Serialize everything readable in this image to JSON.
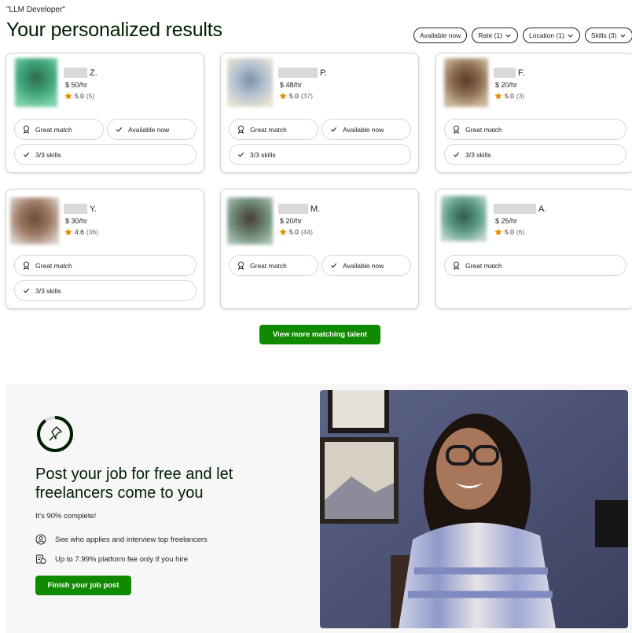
{
  "search": {
    "query": "\"LLM Developer\""
  },
  "page": {
    "title": "Your personalized results"
  },
  "filters": [
    {
      "label": "Available now",
      "has_menu": false
    },
    {
      "label": "Rate (1)",
      "has_menu": true
    },
    {
      "label": "Location (1)",
      "has_menu": true
    },
    {
      "label": "Skills (3)",
      "has_menu": true
    }
  ],
  "talent": [
    {
      "name_initial": "Z.",
      "rate": "$ 50/hr",
      "rating": "5.0",
      "reviews": "(5)",
      "tags": [
        "Great match",
        "Available now",
        "3/3 skills"
      ]
    },
    {
      "name_initial": "P.",
      "rate": "$ 48/hr",
      "rating": "5.0",
      "reviews": "(37)",
      "tags": [
        "Great match",
        "Available now",
        "3/3 skills"
      ]
    },
    {
      "name_initial": "F.",
      "rate": "$ 20/hr",
      "rating": "5.0",
      "reviews": "(3)",
      "tags": [
        "Great match",
        "3/3 skills"
      ]
    },
    {
      "name_initial": "Y.",
      "rate": "$ 30/hr",
      "rating": "4.6",
      "reviews": "(36)",
      "tags": [
        "Great match",
        "3/3 skills"
      ]
    },
    {
      "name_initial": "M.",
      "rate": "$ 20/hr",
      "rating": "5.0",
      "reviews": "(44)",
      "tags": [
        "Great match",
        "Available now"
      ]
    },
    {
      "name_initial": "A.",
      "rate": "$ 25/hr",
      "rating": "5.0",
      "reviews": "(6)",
      "tags": [
        "Great match"
      ]
    }
  ],
  "actions": {
    "view_more": "View more matching talent"
  },
  "promo": {
    "title": "Post your job for free and let freelancers come to you",
    "progress_text": "It's 90% complete!",
    "progress": 0.9,
    "bullets": [
      {
        "icon": "person-circle-icon",
        "text": "See who applies and interview top freelancers"
      },
      {
        "icon": "fee-tag-icon",
        "text": "Up to 7.99% platform fee only if you hire"
      }
    ],
    "cta": "Finish your job post"
  },
  "colors": {
    "brand_green": "#108a00",
    "star_orange": "#e08a00",
    "text_dark": "#001e00"
  }
}
